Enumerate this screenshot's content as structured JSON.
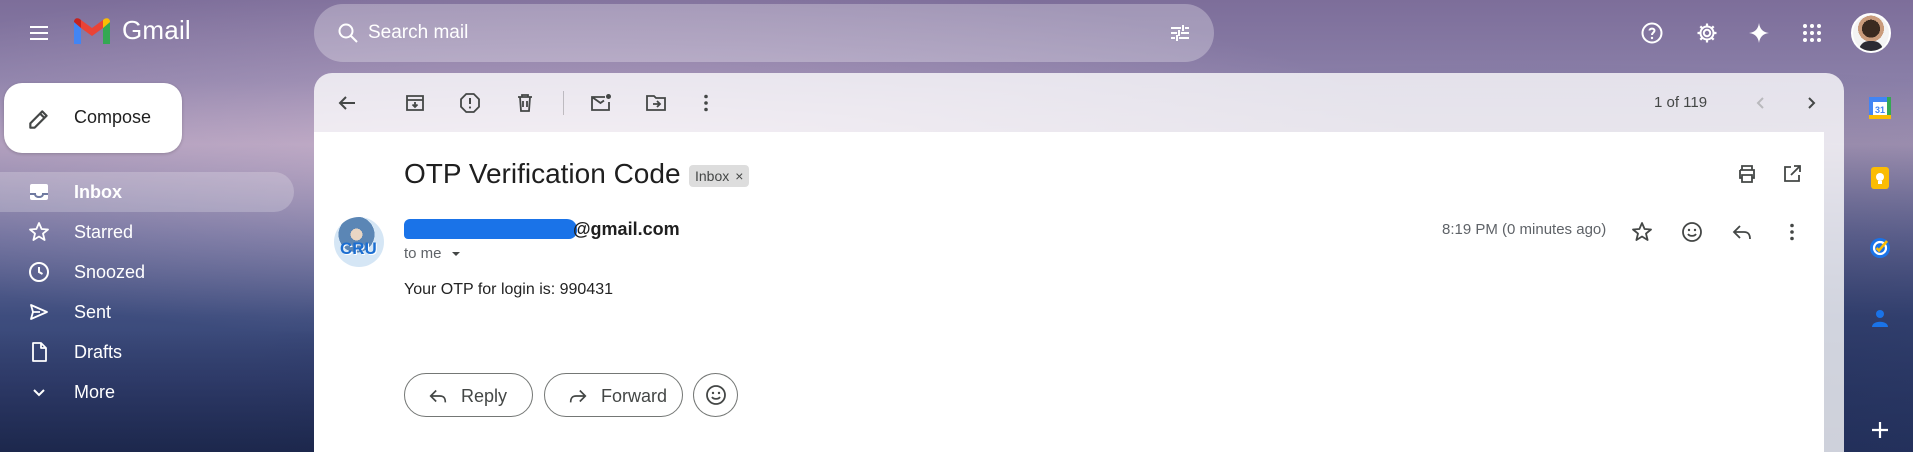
{
  "app": {
    "name": "Gmail",
    "brand_colors": {
      "red": "#ea4335",
      "blue": "#4285f4",
      "green": "#34a853",
      "yellow": "#fbbc04"
    }
  },
  "header": {
    "menu_icon": "hamburger-icon",
    "search_placeholder": "Search mail",
    "right_icons": [
      "help-icon",
      "settings-icon",
      "gemini-icon",
      "apps-icon",
      "account-avatar"
    ]
  },
  "compose": {
    "label": "Compose"
  },
  "sidebar": {
    "items": [
      {
        "label": "Inbox",
        "icon": "inbox-icon",
        "active": true
      },
      {
        "label": "Starred",
        "icon": "star-icon",
        "active": false
      },
      {
        "label": "Snoozed",
        "icon": "clock-icon",
        "active": false
      },
      {
        "label": "Sent",
        "icon": "send-icon",
        "active": false
      },
      {
        "label": "Drafts",
        "icon": "draft-icon",
        "active": false
      },
      {
        "label": "More",
        "icon": "chevron-down-icon",
        "active": false
      }
    ]
  },
  "toolbar": {
    "icons": [
      "back-arrow-icon",
      "archive-icon",
      "report-spam-icon",
      "delete-icon",
      "mark-unread-icon",
      "move-to-icon",
      "more-vert-icon"
    ],
    "pager_text": "1 of 119",
    "pager_icons": [
      "chevron-left-icon",
      "chevron-right-icon"
    ]
  },
  "message": {
    "subject": "OTP Verification Code",
    "label_chip": "Inbox",
    "label_chip_close": "×",
    "sender_email_visible": "@gmail.com",
    "avatar_text": "CRU",
    "to_text": "to me",
    "timestamp": "8:19 PM (0 minutes ago)",
    "body": "Your OTP for login is: 990431"
  },
  "actions": {
    "reply_label": "Reply",
    "forward_label": "Forward"
  },
  "side_panel": {
    "apps": [
      "calendar-icon",
      "keep-icon",
      "tasks-icon",
      "contacts-icon",
      "add-icon"
    ],
    "calendar_day": "31"
  }
}
